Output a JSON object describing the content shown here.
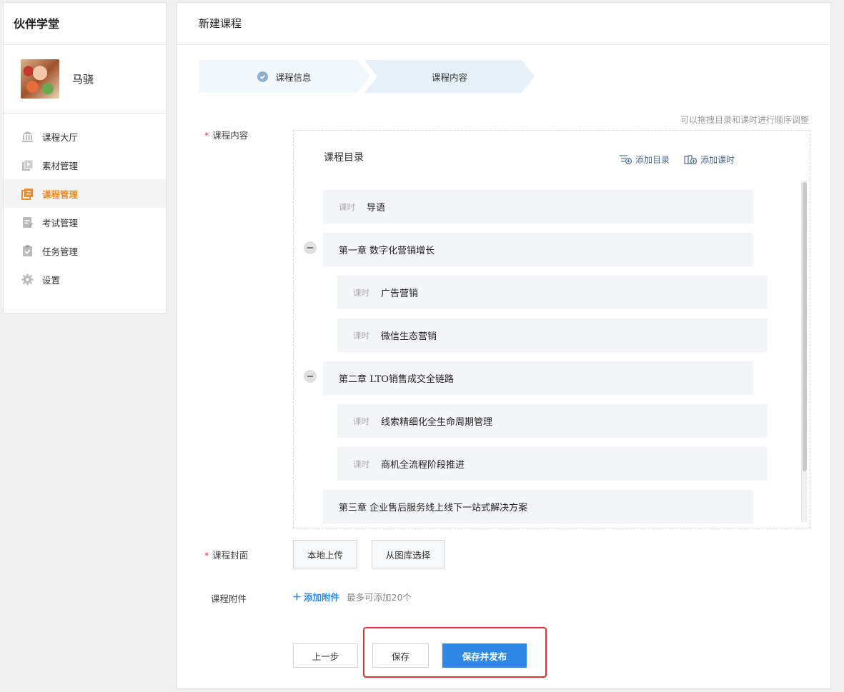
{
  "sidebar": {
    "brand": "伙伴学堂",
    "user_name": "马骁",
    "items": [
      {
        "label": "课程大厅",
        "icon": "bank-icon",
        "active": false
      },
      {
        "label": "素材管理",
        "icon": "media-icon",
        "active": false
      },
      {
        "label": "课程管理",
        "icon": "course-icon",
        "active": true
      },
      {
        "label": "考试管理",
        "icon": "exam-icon",
        "active": false
      },
      {
        "label": "任务管理",
        "icon": "task-icon",
        "active": false
      },
      {
        "label": "设置",
        "icon": "gear-icon",
        "active": false
      }
    ]
  },
  "main": {
    "title": "新建课程",
    "steps": [
      {
        "label": "课程信息",
        "done": true
      },
      {
        "label": "课程内容",
        "done": false
      }
    ],
    "drag_hint": "可以拖拽目录和课时进行顺序调整",
    "content_label": "课程内容",
    "catalog": {
      "title": "课程目录",
      "add_directory": "添加目录",
      "add_lesson": "添加课时",
      "lesson_tag": "课时",
      "items": [
        {
          "type": "lesson",
          "text": "导语"
        },
        {
          "type": "chapter",
          "text": "第一章 数字化营销增长"
        },
        {
          "type": "lesson",
          "text": "广告营销"
        },
        {
          "type": "lesson",
          "text": "微信生态营销"
        },
        {
          "type": "chapter",
          "text": "第二章 LTO销售成交全链路"
        },
        {
          "type": "lesson",
          "text": "线索精细化全生命周期管理"
        },
        {
          "type": "lesson",
          "text": "商机全流程阶段推进"
        },
        {
          "type": "chapter",
          "text": "第三章 企业售后服务线上线下一站式解决方案"
        }
      ]
    },
    "cover": {
      "label": "课程封面",
      "local_upload": "本地上传",
      "from_library": "从图库选择"
    },
    "attachment": {
      "label": "课程附件",
      "add": "添加附件",
      "hint": "最多可添加20个"
    },
    "footer": {
      "prev": "上一步",
      "save": "保存",
      "save_publish": "保存并发布"
    }
  },
  "colors": {
    "accent": "#2f88e3",
    "active_nav": "#f08a24",
    "highlight_box": "#e23232"
  }
}
